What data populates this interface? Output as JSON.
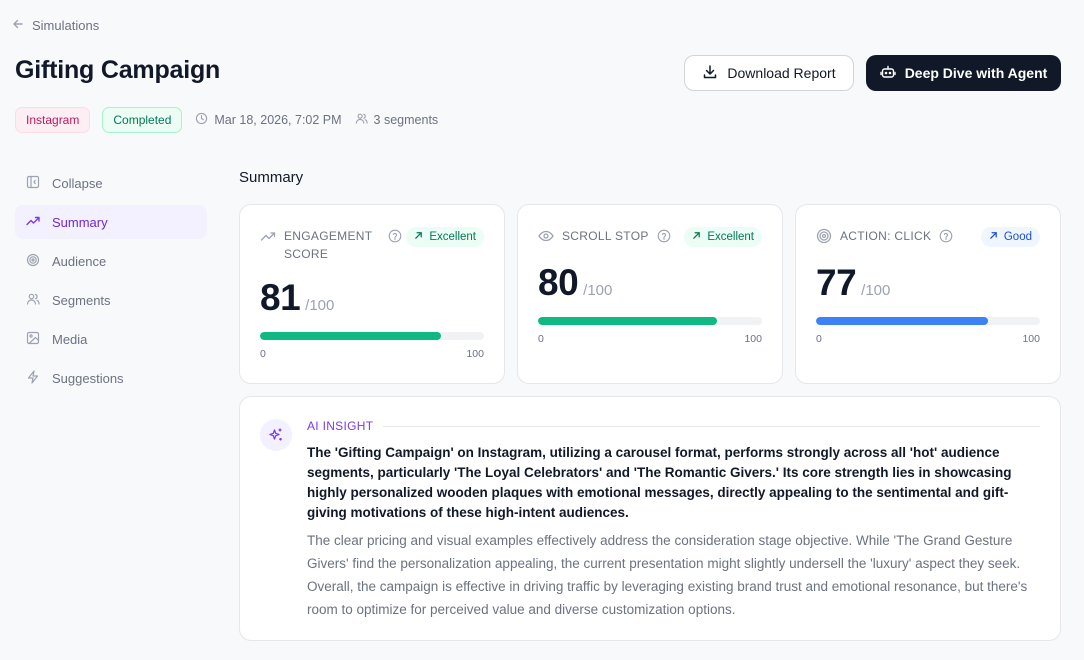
{
  "header": {
    "back_label": "Simulations",
    "title": "Gifting Campaign",
    "download_label": "Download Report",
    "agent_label": "Deep Dive with Agent"
  },
  "meta": {
    "platform": "Instagram",
    "status": "Completed",
    "date": "Mar 18, 2026, 7:02 PM",
    "segments": "3 segments"
  },
  "sidebar": {
    "items": [
      {
        "label": "Collapse",
        "icon": "collapse-icon"
      },
      {
        "label": "Summary",
        "icon": "trending-icon",
        "active": true
      },
      {
        "label": "Audience",
        "icon": "target-icon"
      },
      {
        "label": "Segments",
        "icon": "users-icon"
      },
      {
        "label": "Media",
        "icon": "image-icon"
      },
      {
        "label": "Suggestions",
        "icon": "bolt-icon"
      }
    ]
  },
  "summary": {
    "title": "Summary",
    "metrics": [
      {
        "label": "ENGAGEMENT SCORE",
        "badge": "Excellent",
        "value": "81",
        "denominator": "/100",
        "percent": 81,
        "min": "0",
        "max": "100",
        "color": "#10b981"
      },
      {
        "label": "SCROLL STOP",
        "badge": "Excellent",
        "value": "80",
        "denominator": "/100",
        "percent": 80,
        "min": "0",
        "max": "100",
        "color": "#10b981"
      },
      {
        "label": "ACTION: CLICK",
        "badge": "Good",
        "value": "77",
        "denominator": "/100",
        "percent": 77,
        "min": "0",
        "max": "100",
        "color": "#3b82f6"
      }
    ]
  },
  "insight": {
    "label": "AI INSIGHT",
    "headline": "The 'Gifting Campaign' on Instagram, utilizing a carousel format, performs strongly across all 'hot' audience segments, particularly 'The Loyal Celebrators' and 'The Romantic Givers.' Its core strength lies in showcasing highly personalized wooden plaques with emotional messages, directly appealing to the sentimental and gift-giving motivations of these high-intent audiences.",
    "body": "The clear pricing and visual examples effectively address the consideration stage objective. While 'The Grand Gesture Givers' find the personalization appealing, the current presentation might slightly undersell the 'luxury' aspect they seek. Overall, the campaign is effective in driving traffic by leveraging existing brand trust and emotional resonance, but there's room to optimize for perceived value and diverse customization options."
  }
}
